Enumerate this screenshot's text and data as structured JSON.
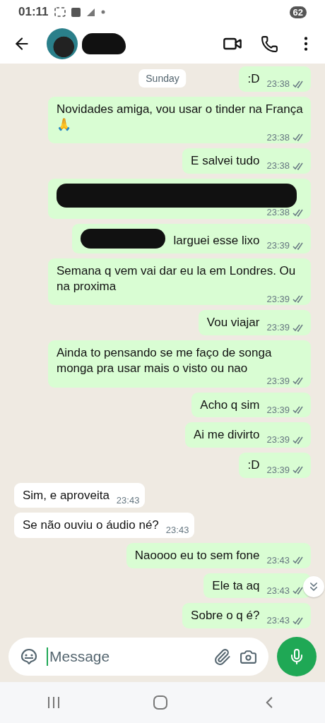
{
  "status_bar": {
    "time": "01:11",
    "battery": "62"
  },
  "header": {
    "name_redacted": true
  },
  "date_chip": "Sunday",
  "messages": [
    {
      "kind": "outgoing",
      "text": ":D",
      "time": "23:38"
    },
    {
      "kind": "outgoing",
      "text": "Novidades amiga, vou usar o tinder na França 🙏",
      "time": "23:38"
    },
    {
      "kind": "outgoing",
      "text": "E salvei tudo",
      "time": "23:38"
    },
    {
      "kind": "outgoing",
      "redacted": true,
      "time": "23:38"
    },
    {
      "kind": "outgoing",
      "redacted": true,
      "text": "larguei esse lixo",
      "time": "23:39"
    },
    {
      "kind": "outgoing",
      "text": "Semana q vem vai dar eu la em Londres. Ou na proxima",
      "time": "23:39"
    },
    {
      "kind": "outgoing",
      "text": "Vou viajar",
      "time": "23:39"
    },
    {
      "kind": "outgoing",
      "text": "Ainda to pensando se me faço de songa monga pra usar mais o visto ou nao",
      "time": "23:39"
    },
    {
      "kind": "outgoing",
      "text": "Acho q sim",
      "time": "23:39"
    },
    {
      "kind": "outgoing",
      "text": "Ai me divirto",
      "time": "23:39"
    },
    {
      "kind": "outgoing",
      "text": ":D",
      "time": "23:39"
    },
    {
      "kind": "incoming",
      "text": "Sim, e aproveita",
      "time": "23:43"
    },
    {
      "kind": "incoming",
      "text": "Se não ouviu o áudio né?",
      "time": "23:43"
    },
    {
      "kind": "outgoing",
      "text": "Naoooo eu to sem fone",
      "time": "23:43"
    },
    {
      "kind": "outgoing",
      "text": "Ele ta aq",
      "time": "23:43"
    },
    {
      "kind": "outgoing",
      "text": "Sobre o q é?",
      "time": "23:43"
    }
  ],
  "composer": {
    "placeholder": "Message"
  }
}
